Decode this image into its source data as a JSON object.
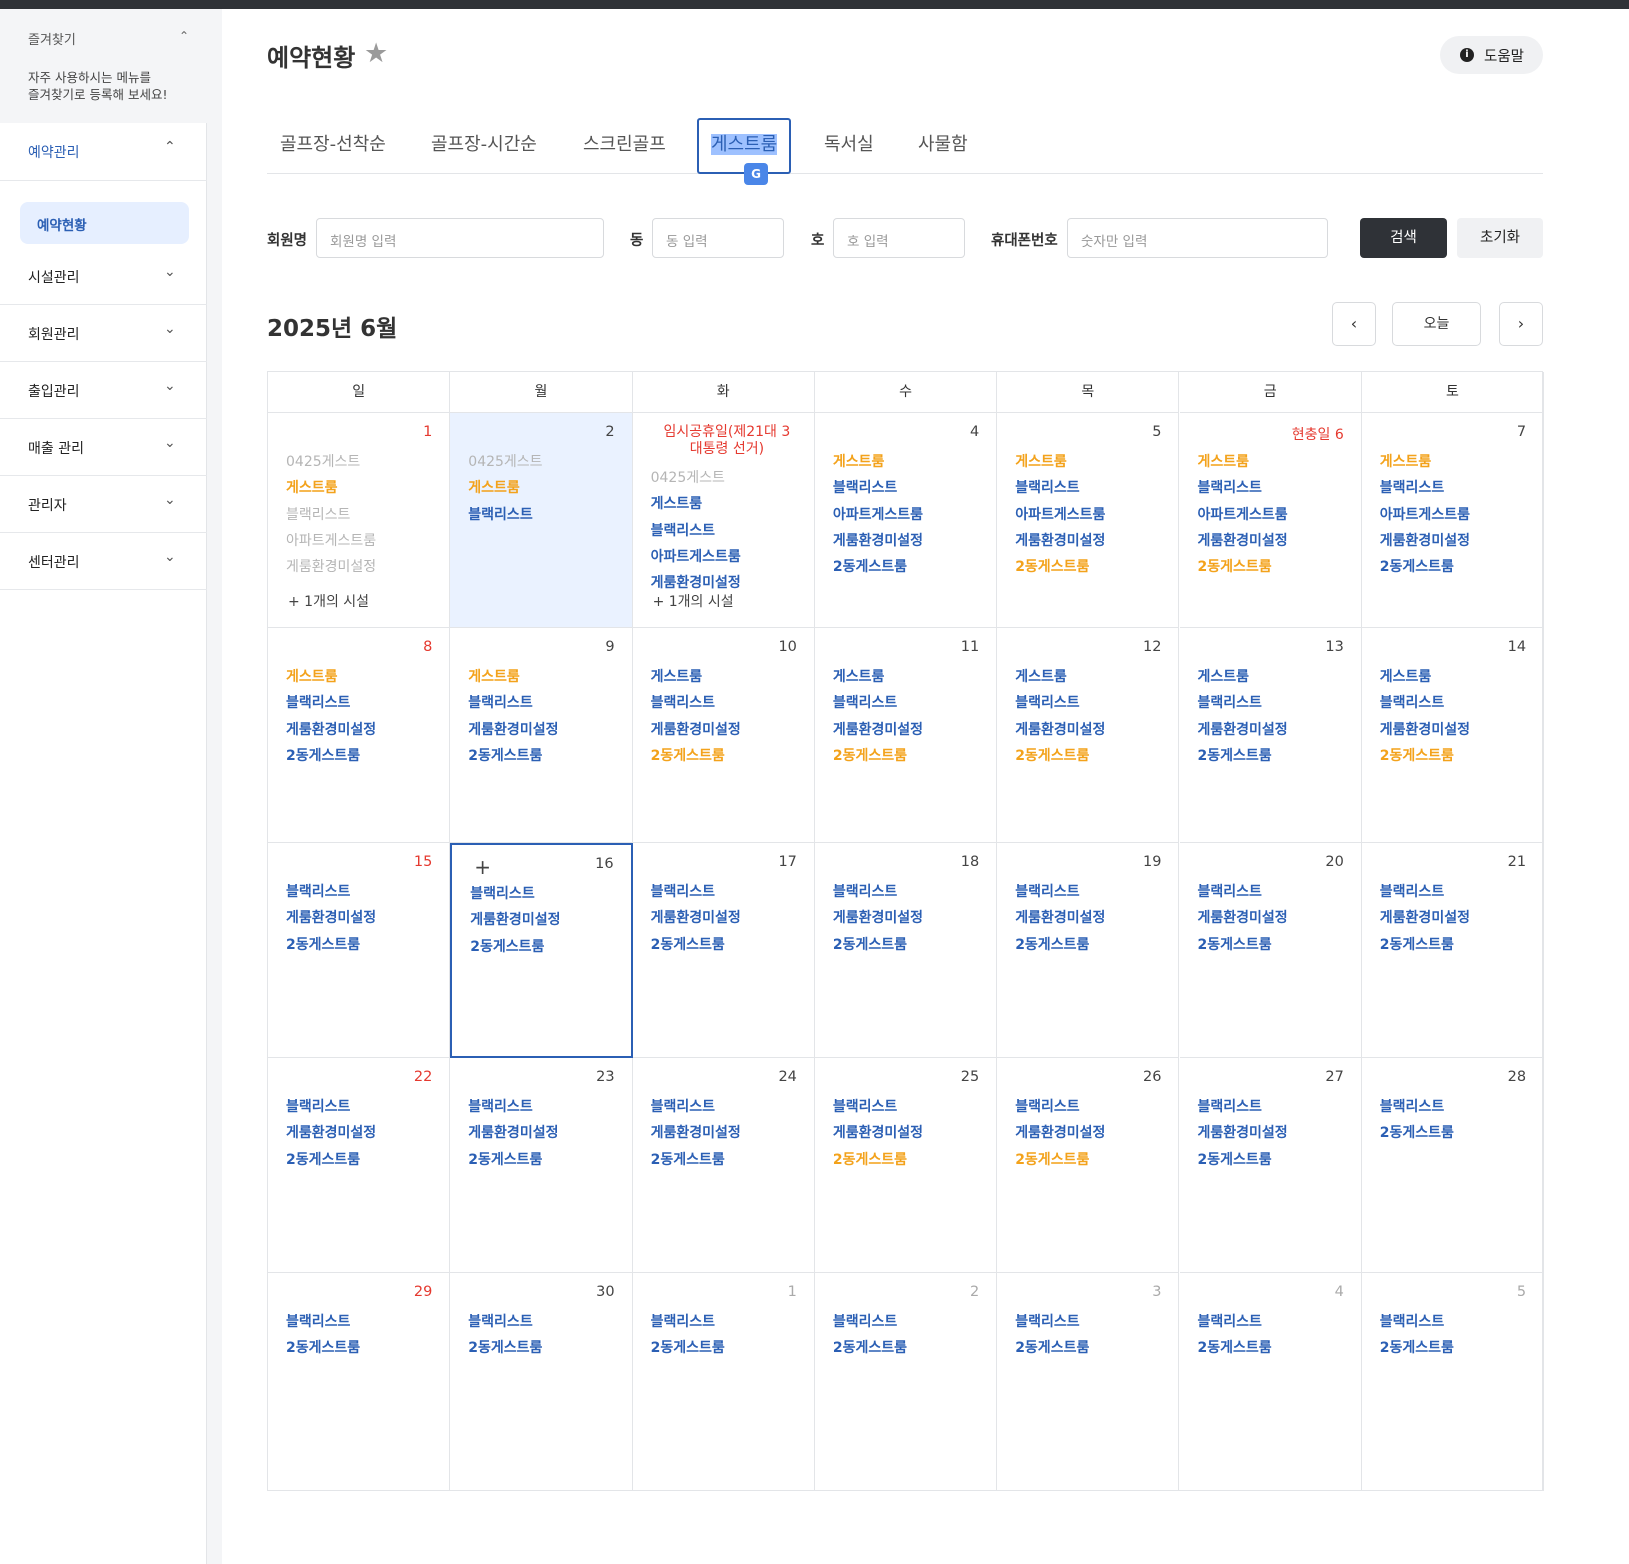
{
  "favorites": {
    "title": "즐겨찾기",
    "desc": "자주 사용하시는 메뉴를\n즐겨찾기로 등록해 보세요!"
  },
  "menu": [
    {
      "label": "예약관리",
      "active": true
    },
    {
      "label": "시설관리"
    },
    {
      "label": "회원관리"
    },
    {
      "label": "출입관리"
    },
    {
      "label": "매출 관리"
    },
    {
      "label": "관리자"
    },
    {
      "label": "센터관리"
    }
  ],
  "submenu": {
    "label": "예약현황"
  },
  "page": {
    "title": "예약현황",
    "help_label": "도움말"
  },
  "tabs": [
    "골프장-선착순",
    "골프장-시간순",
    "스크린골프",
    "게스트룸",
    "독서실",
    "사물함"
  ],
  "filters": {
    "member_label": "회원명",
    "member_placeholder": "회원명 입력",
    "dong_label": "동",
    "dong_placeholder": "동 입력",
    "ho_label": "호",
    "ho_placeholder": "호 입력",
    "phone_label": "휴대폰번호",
    "phone_placeholder": "숫자만 입력",
    "search_label": "검색",
    "reset_label": "초기화"
  },
  "calendar": {
    "month_title": "2025년 6월",
    "today_label": "오늘",
    "weekdays": [
      "일",
      "월",
      "화",
      "수",
      "목",
      "금",
      "토"
    ],
    "colors": {
      "blue": "#2b5fb4",
      "orange": "#f3a21b",
      "red": "#e5392f",
      "gray": "#b5b5b5"
    },
    "weeks": [
      [
        {
          "day": "1",
          "style": "red",
          "events": [
            [
              "0425게스트",
              "gray"
            ],
            [
              "게스트룸",
              "orange"
            ],
            [
              "블랙리스트",
              "gray"
            ],
            [
              "아파트게스트룸",
              "gray"
            ],
            [
              "게룸환경미설정",
              "gray"
            ]
          ],
          "more": "+ 1개의 시설"
        },
        {
          "day": "2",
          "today": true,
          "events": [
            [
              "0425게스트",
              "gray"
            ],
            [
              "게스트룸",
              "orange"
            ],
            [
              "블랙리스트",
              "blue"
            ]
          ]
        },
        {
          "holiday": "임시공휴일(제21대 3\n대통령 선거)",
          "events": [
            [
              "0425게스트",
              "gray"
            ],
            [
              "게스트룸",
              "blue"
            ],
            [
              "블랙리스트",
              "blue"
            ],
            [
              "아파트게스트룸",
              "blue"
            ],
            [
              "게룸환경미설정",
              "blue"
            ]
          ],
          "more": "+ 1개의 시설"
        },
        {
          "day": "4",
          "events": [
            [
              "게스트룸",
              "orange"
            ],
            [
              "블랙리스트",
              "blue"
            ],
            [
              "아파트게스트룸",
              "blue"
            ],
            [
              "게룸환경미설정",
              "blue"
            ],
            [
              "2동게스트룸",
              "blue"
            ]
          ]
        },
        {
          "day": "5",
          "events": [
            [
              "게스트룸",
              "orange"
            ],
            [
              "블랙리스트",
              "blue"
            ],
            [
              "아파트게스트룸",
              "blue"
            ],
            [
              "게룸환경미설정",
              "blue"
            ],
            [
              "2동게스트룸",
              "orange"
            ]
          ]
        },
        {
          "holiday2": "현충일 6",
          "events": [
            [
              "게스트룸",
              "orange"
            ],
            [
              "블랙리스트",
              "blue"
            ],
            [
              "아파트게스트룸",
              "blue"
            ],
            [
              "게룸환경미설정",
              "blue"
            ],
            [
              "2동게스트룸",
              "orange"
            ]
          ]
        },
        {
          "day": "7",
          "events": [
            [
              "게스트룸",
              "orange"
            ],
            [
              "블랙리스트",
              "blue"
            ],
            [
              "아파트게스트룸",
              "blue"
            ],
            [
              "게룸환경미설정",
              "blue"
            ],
            [
              "2동게스트룸",
              "blue"
            ]
          ]
        }
      ],
      [
        {
          "day": "8",
          "style": "red",
          "events": [
            [
              "게스트룸",
              "orange"
            ],
            [
              "블랙리스트",
              "blue"
            ],
            [
              "게룸환경미설정",
              "blue"
            ],
            [
              "2동게스트룸",
              "blue"
            ]
          ]
        },
        {
          "day": "9",
          "events": [
            [
              "게스트룸",
              "orange"
            ],
            [
              "블랙리스트",
              "blue"
            ],
            [
              "게룸환경미설정",
              "blue"
            ],
            [
              "2동게스트룸",
              "blue"
            ]
          ]
        },
        {
          "day": "10",
          "events": [
            [
              "게스트룸",
              "blue"
            ],
            [
              "블랙리스트",
              "blue"
            ],
            [
              "게룸환경미설정",
              "blue"
            ],
            [
              "2동게스트룸",
              "orange"
            ]
          ]
        },
        {
          "day": "11",
          "events": [
            [
              "게스트룸",
              "blue"
            ],
            [
              "블랙리스트",
              "blue"
            ],
            [
              "게룸환경미설정",
              "blue"
            ],
            [
              "2동게스트룸",
              "orange"
            ]
          ]
        },
        {
          "day": "12",
          "events": [
            [
              "게스트룸",
              "blue"
            ],
            [
              "블랙리스트",
              "blue"
            ],
            [
              "게룸환경미설정",
              "blue"
            ],
            [
              "2동게스트룸",
              "orange"
            ]
          ]
        },
        {
          "day": "13",
          "events": [
            [
              "게스트룸",
              "blue"
            ],
            [
              "블랙리스트",
              "blue"
            ],
            [
              "게룸환경미설정",
              "blue"
            ],
            [
              "2동게스트룸",
              "blue"
            ]
          ]
        },
        {
          "day": "14",
          "events": [
            [
              "게스트룸",
              "blue"
            ],
            [
              "블랙리스트",
              "blue"
            ],
            [
              "게룸환경미설정",
              "blue"
            ],
            [
              "2동게스트룸",
              "orange"
            ]
          ]
        }
      ],
      [
        {
          "day": "15",
          "style": "red",
          "events": [
            [
              "블랙리스트",
              "blue"
            ],
            [
              "게룸환경미설정",
              "blue"
            ],
            [
              "2동게스트룸",
              "blue"
            ]
          ]
        },
        {
          "day": "16",
          "selected": true,
          "events": [
            [
              "블랙리스트",
              "blue"
            ],
            [
              "게룸환경미설정",
              "blue"
            ],
            [
              "2동게스트룸",
              "blue"
            ]
          ]
        },
        {
          "day": "17",
          "events": [
            [
              "블랙리스트",
              "blue"
            ],
            [
              "게룸환경미설정",
              "blue"
            ],
            [
              "2동게스트룸",
              "blue"
            ]
          ]
        },
        {
          "day": "18",
          "events": [
            [
              "블랙리스트",
              "blue"
            ],
            [
              "게룸환경미설정",
              "blue"
            ],
            [
              "2동게스트룸",
              "blue"
            ]
          ]
        },
        {
          "day": "19",
          "events": [
            [
              "블랙리스트",
              "blue"
            ],
            [
              "게룸환경미설정",
              "blue"
            ],
            [
              "2동게스트룸",
              "blue"
            ]
          ]
        },
        {
          "day": "20",
          "events": [
            [
              "블랙리스트",
              "blue"
            ],
            [
              "게룸환경미설정",
              "blue"
            ],
            [
              "2동게스트룸",
              "blue"
            ]
          ]
        },
        {
          "day": "21",
          "events": [
            [
              "블랙리스트",
              "blue"
            ],
            [
              "게룸환경미설정",
              "blue"
            ],
            [
              "2동게스트룸",
              "blue"
            ]
          ]
        }
      ],
      [
        {
          "day": "22",
          "style": "red",
          "events": [
            [
              "블랙리스트",
              "blue"
            ],
            [
              "게룸환경미설정",
              "blue"
            ],
            [
              "2동게스트룸",
              "blue"
            ]
          ]
        },
        {
          "day": "23",
          "events": [
            [
              "블랙리스트",
              "blue"
            ],
            [
              "게룸환경미설정",
              "blue"
            ],
            [
              "2동게스트룸",
              "blue"
            ]
          ]
        },
        {
          "day": "24",
          "events": [
            [
              "블랙리스트",
              "blue"
            ],
            [
              "게룸환경미설정",
              "blue"
            ],
            [
              "2동게스트룸",
              "blue"
            ]
          ]
        },
        {
          "day": "25",
          "events": [
            [
              "블랙리스트",
              "blue"
            ],
            [
              "게룸환경미설정",
              "blue"
            ],
            [
              "2동게스트룸",
              "orange"
            ]
          ]
        },
        {
          "day": "26",
          "events": [
            [
              "블랙리스트",
              "blue"
            ],
            [
              "게룸환경미설정",
              "blue"
            ],
            [
              "2동게스트룸",
              "orange"
            ]
          ]
        },
        {
          "day": "27",
          "events": [
            [
              "블랙리스트",
              "blue"
            ],
            [
              "게룸환경미설정",
              "blue"
            ],
            [
              "2동게스트룸",
              "blue"
            ]
          ]
        },
        {
          "day": "28",
          "events": [
            [
              "블랙리스트",
              "blue"
            ],
            [
              "2동게스트룸",
              "blue"
            ]
          ]
        }
      ],
      [
        {
          "day": "29",
          "style": "red",
          "events": [
            [
              "블랙리스트",
              "blue"
            ],
            [
              "2동게스트룸",
              "blue"
            ]
          ]
        },
        {
          "day": "30",
          "events": [
            [
              "블랙리스트",
              "blue"
            ],
            [
              "2동게스트룸",
              "blue"
            ]
          ]
        },
        {
          "day": "1",
          "style": "gray",
          "events": [
            [
              "블랙리스트",
              "blue"
            ],
            [
              "2동게스트룸",
              "blue"
            ]
          ]
        },
        {
          "day": "2",
          "style": "gray",
          "events": [
            [
              "블랙리스트",
              "blue"
            ],
            [
              "2동게스트룸",
              "blue"
            ]
          ]
        },
        {
          "day": "3",
          "style": "gray",
          "events": [
            [
              "블랙리스트",
              "blue"
            ],
            [
              "2동게스트룸",
              "blue"
            ]
          ]
        },
        {
          "day": "4",
          "style": "gray",
          "events": [
            [
              "블랙리스트",
              "blue"
            ],
            [
              "2동게스트룸",
              "blue"
            ]
          ]
        },
        {
          "day": "5",
          "style": "gray",
          "events": [
            [
              "블랙리스트",
              "blue"
            ],
            [
              "2동게스트룸",
              "blue"
            ]
          ]
        }
      ]
    ]
  }
}
